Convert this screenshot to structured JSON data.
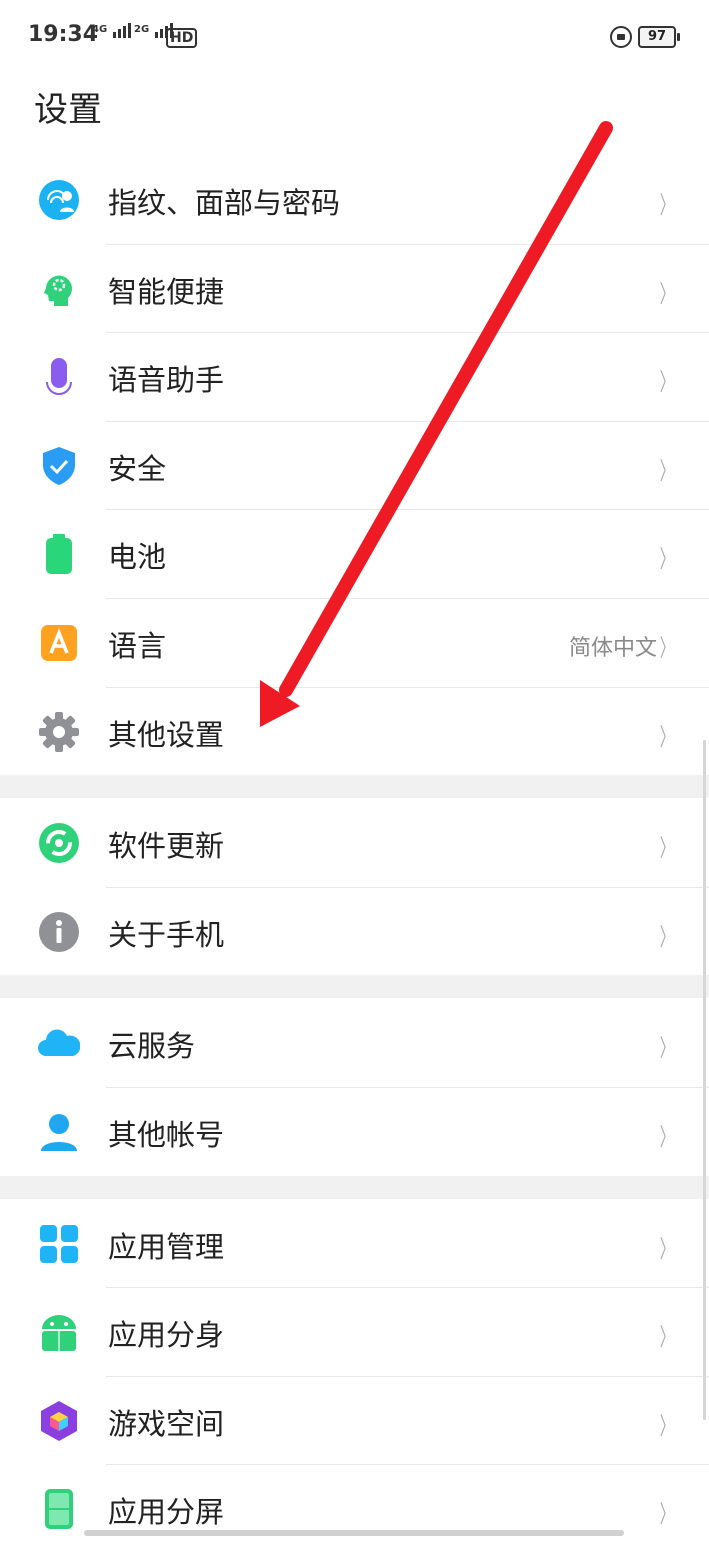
{
  "status_bar": {
    "time": "19:34",
    "net1": "4G",
    "net2": "2G",
    "hd": "HD",
    "battery": "97"
  },
  "header": {
    "title": "设置"
  },
  "groups": [
    {
      "items": [
        {
          "label": "指纹、面部与密码",
          "icon": "fingerprint-face-icon",
          "color": "#1ab2f0"
        },
        {
          "label": "智能便捷",
          "icon": "smart-head-icon",
          "color": "#2fd27a"
        },
        {
          "label": "语音助手",
          "icon": "microphone-icon",
          "color": "#8a5cf0"
        },
        {
          "label": "安全",
          "icon": "shield-check-icon",
          "color": "#2b9cf3"
        },
        {
          "label": "电池",
          "icon": "battery-icon",
          "color": "#29d67a"
        },
        {
          "label": "语言",
          "value": "简体中文",
          "icon": "language-a-icon",
          "color": "#ffa21f"
        },
        {
          "label": "其他设置",
          "icon": "gear-icon",
          "color": "#8f9196"
        }
      ]
    },
    {
      "items": [
        {
          "label": "软件更新",
          "icon": "update-cycle-icon",
          "color": "#2fd27a"
        },
        {
          "label": "关于手机",
          "icon": "info-icon",
          "color": "#8f9196"
        }
      ]
    },
    {
      "items": [
        {
          "label": "云服务",
          "icon": "cloud-icon",
          "color": "#1fb4f5"
        },
        {
          "label": "其他帐号",
          "icon": "person-icon",
          "color": "#1fa8f0"
        }
      ]
    },
    {
      "items": [
        {
          "label": "应用管理",
          "icon": "app-grid-icon",
          "color": "#1fb4f5"
        },
        {
          "label": "应用分身",
          "icon": "android-icon",
          "color": "#2fd27a"
        },
        {
          "label": "游戏空间",
          "icon": "game-cube-icon",
          "color": "#8c3fe0"
        },
        {
          "label": "应用分屏",
          "icon": "split-screen-icon",
          "color": "#2fd27a"
        }
      ]
    }
  ],
  "annotation": {
    "color": "#ee1b24"
  },
  "chevron": "〉"
}
